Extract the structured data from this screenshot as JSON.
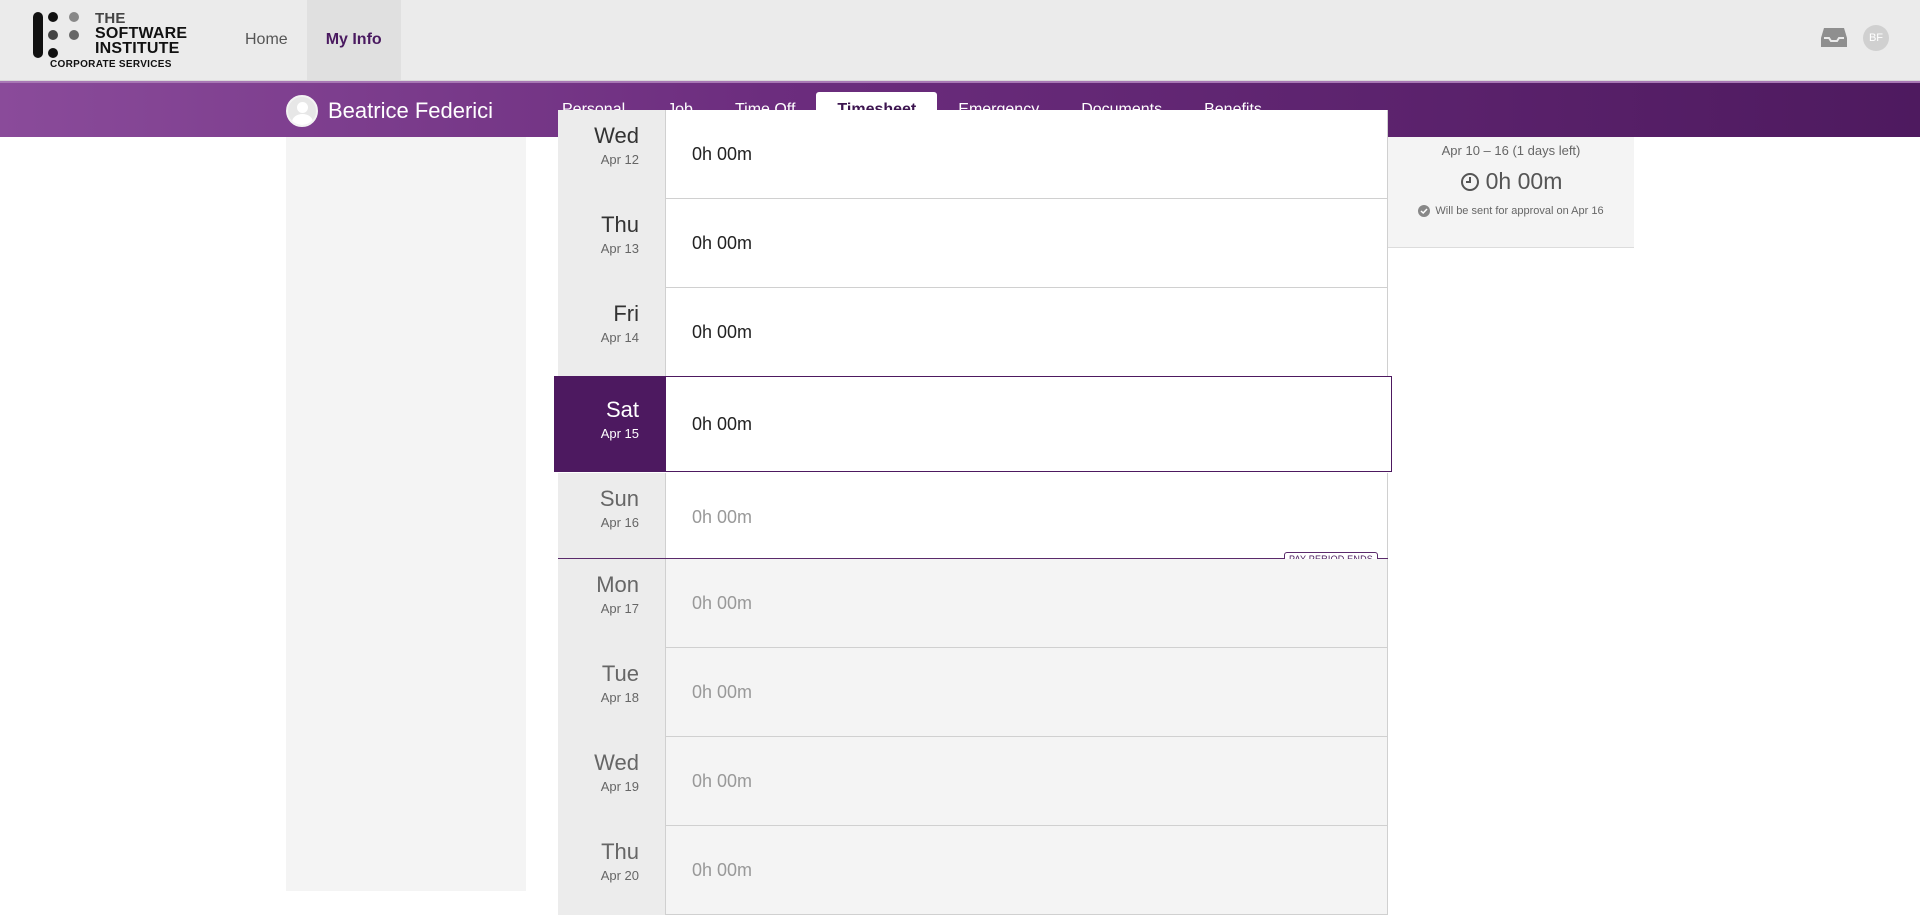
{
  "header": {
    "logo": {
      "line1": "THE",
      "line2": "SOFTWARE",
      "line3": "INSTITUTE",
      "sub": "CORPORATE SERVICES"
    },
    "nav": [
      {
        "label": "Home"
      },
      {
        "label": "My Info"
      }
    ],
    "user_initials": "BF"
  },
  "profile": {
    "name": "Beatrice Federici",
    "tabs": [
      {
        "label": "Personal"
      },
      {
        "label": "Job"
      },
      {
        "label": "Time Off"
      },
      {
        "label": "Timesheet"
      },
      {
        "label": "Emergency"
      },
      {
        "label": "Documents"
      },
      {
        "label": "Benefits"
      }
    ]
  },
  "summary": {
    "range": "Apr 10 – 16 (1 days left)",
    "total": "0h 00m",
    "note": "Will be sent for approval on Apr 16"
  },
  "timesheet": {
    "days": [
      {
        "name": "Wed",
        "date": "Apr 12",
        "hours": "0h 00m"
      },
      {
        "name": "Thu",
        "date": "Apr 13",
        "hours": "0h 00m"
      },
      {
        "name": "Fri",
        "date": "Apr 14",
        "hours": "0h 00m"
      },
      {
        "name": "Sat",
        "date": "Apr 15",
        "hours": "0h 00m"
      },
      {
        "name": "Sun",
        "date": "Apr 16",
        "hours": "0h 00m"
      },
      {
        "name": "Mon",
        "date": "Apr 17",
        "hours": "0h 00m"
      },
      {
        "name": "Tue",
        "date": "Apr 18",
        "hours": "0h 00m"
      },
      {
        "name": "Wed",
        "date": "Apr 19",
        "hours": "0h 00m"
      },
      {
        "name": "Thu",
        "date": "Apr 20",
        "hours": "0h 00m"
      }
    ],
    "period_end_label": "PAY PERIOD ENDS"
  },
  "colors": {
    "brand_purple": "#4d1960",
    "accent": "#6c2d7e"
  }
}
